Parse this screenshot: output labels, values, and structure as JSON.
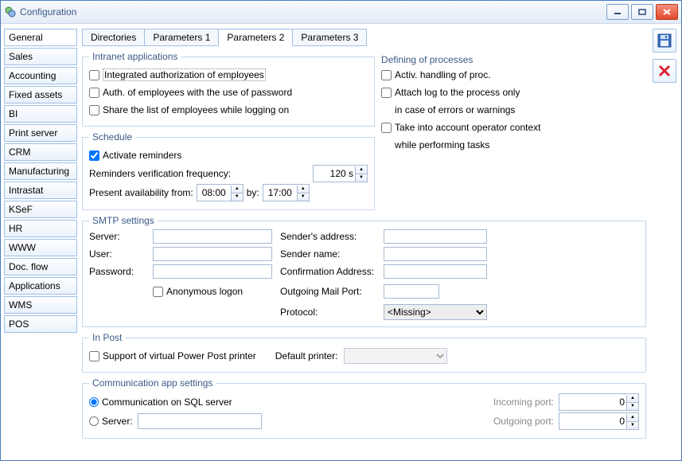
{
  "window": {
    "title": "Configuration"
  },
  "sidebar": {
    "items": [
      {
        "label": "General",
        "selected": true
      },
      {
        "label": "Sales"
      },
      {
        "label": "Accounting"
      },
      {
        "label": "Fixed assets"
      },
      {
        "label": "BI"
      },
      {
        "label": "Print server"
      },
      {
        "label": "CRM"
      },
      {
        "label": "Manufacturing"
      },
      {
        "label": "Intrastat"
      },
      {
        "label": "KSeF"
      },
      {
        "label": "HR"
      },
      {
        "label": "WWW"
      },
      {
        "label": "Doc. flow"
      },
      {
        "label": "Applications"
      },
      {
        "label": "WMS"
      },
      {
        "label": "POS"
      }
    ]
  },
  "tabs": [
    {
      "label": "Directories"
    },
    {
      "label": "Parameters 1"
    },
    {
      "label": "Parameters 2",
      "active": true
    },
    {
      "label": "Parameters 3"
    }
  ],
  "intranet": {
    "legend": "Intranet applications",
    "integrated": "Integrated authorization of employees",
    "auth_pw": "Auth. of employees with the use of password",
    "share": "Share the list of employees while logging on"
  },
  "processes": {
    "legend": "Defining of processes",
    "activ": "Activ. handling of proc.",
    "attach1": "Attach log to the process only",
    "attach2": "in case of errors or warnings",
    "context1": "Take into account operator context",
    "context2": "while performing tasks"
  },
  "schedule": {
    "legend": "Schedule",
    "activate": "Activate reminders",
    "freq_label": "Reminders verification frequency:",
    "freq_value": "120 s",
    "avail_label": "Present availability from:",
    "avail_from": "08:00",
    "avail_by": "by:",
    "avail_to": "17:00"
  },
  "smtp": {
    "legend": "SMTP settings",
    "server_l": "Server:",
    "server_v": "",
    "user_l": "User:",
    "user_v": "",
    "pass_l": "Password:",
    "pass_v": "",
    "anon": "Anonymous logon",
    "sender_addr_l": "Sender's address:",
    "sender_addr_v": "",
    "sender_name_l": "Sender name:",
    "sender_name_v": "",
    "confirm_l": "Confirmation Address:",
    "confirm_v": "",
    "port_l": "Outgoing Mail Port:",
    "port_v": "",
    "proto_l": "Protocol:",
    "proto_v": "<Missing>"
  },
  "inpost": {
    "legend": "In Post",
    "support": "Support of virtual Power Post printer",
    "default_l": "Default printer:",
    "default_v": ""
  },
  "comm": {
    "legend": "Communication app settings",
    "sql": "Communication on SQL server",
    "server_l": "Server:",
    "server_v": "",
    "in_l": "Incoming port:",
    "in_v": "0",
    "out_l": "Outgoing port:",
    "out_v": "0"
  }
}
